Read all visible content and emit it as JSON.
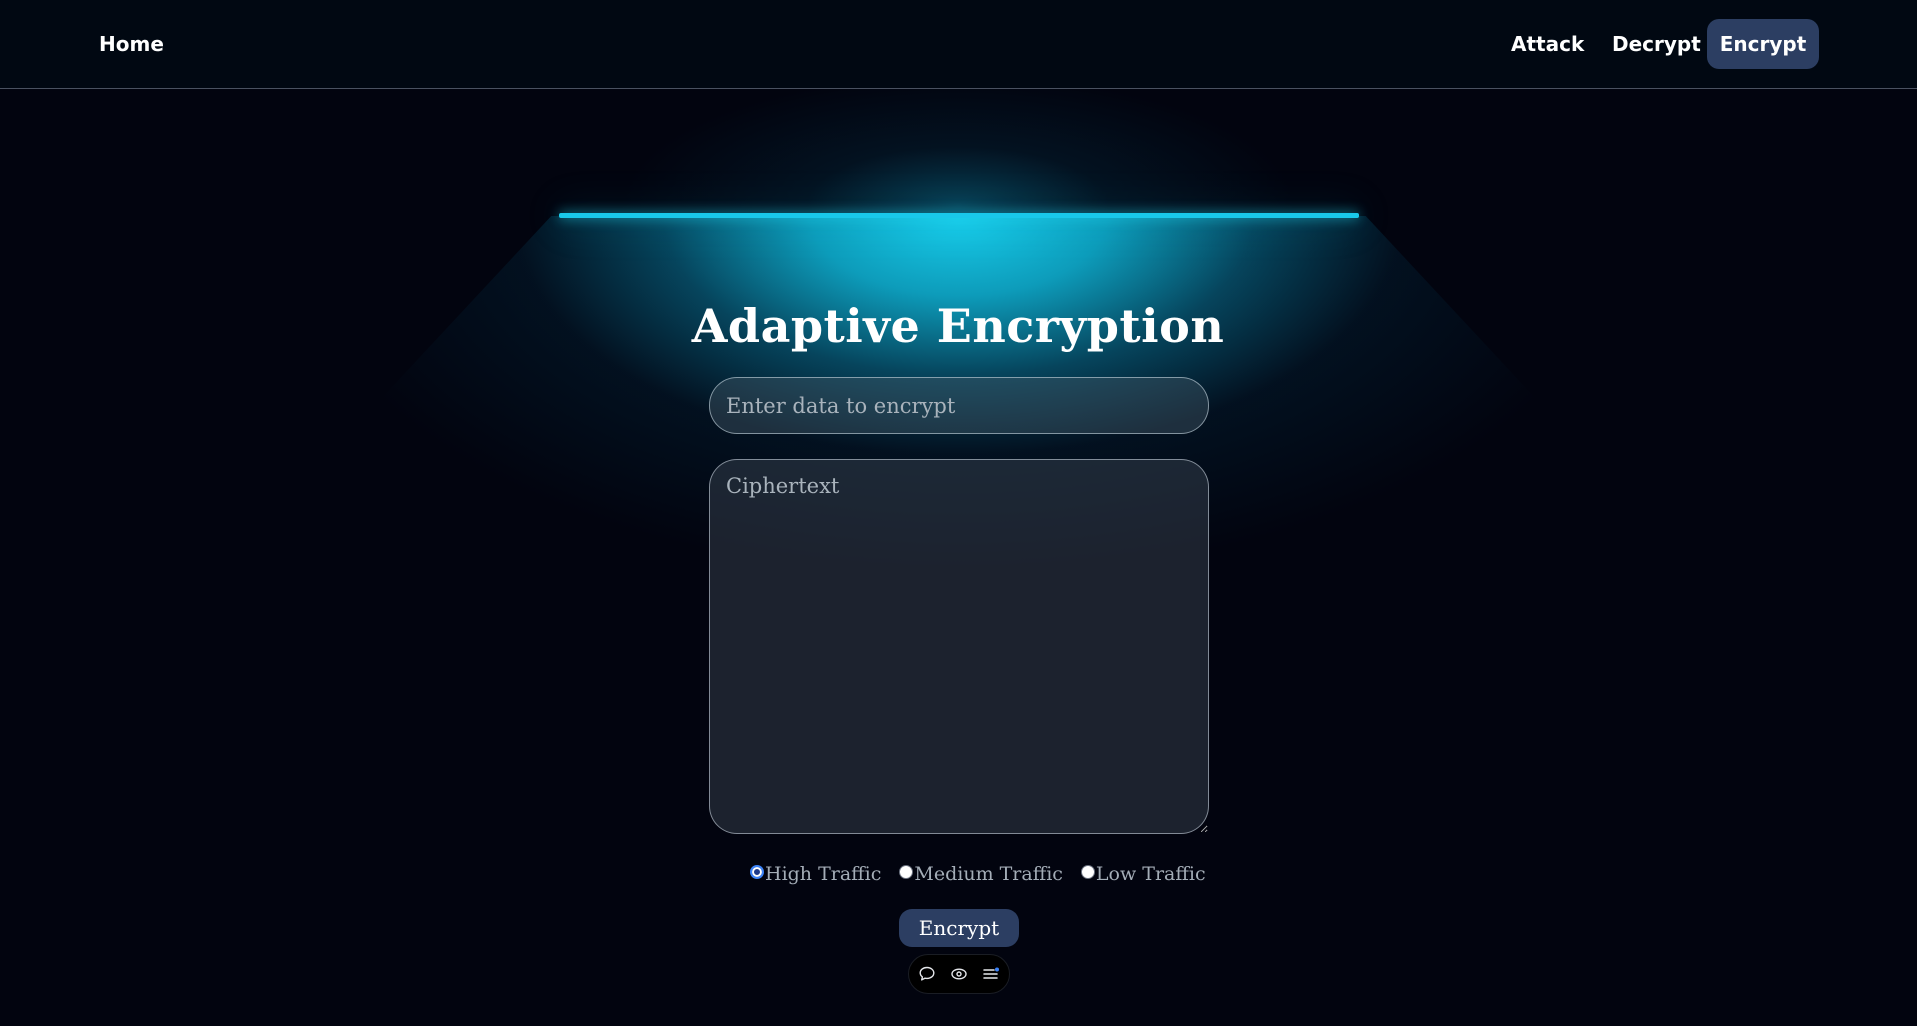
{
  "nav": {
    "home": "Home",
    "attack": "Attack",
    "decrypt": "Decrypt",
    "encrypt": "Encrypt",
    "active_tab": "Encrypt"
  },
  "main": {
    "title": "Adaptive Encryption",
    "data_input": {
      "placeholder": "Enter data to encrypt",
      "value": ""
    },
    "ciphertext": {
      "placeholder": "Ciphertext",
      "value": ""
    },
    "traffic_options": [
      {
        "label": "High Traffic",
        "selected": true
      },
      {
        "label": "Medium Traffic",
        "selected": false
      },
      {
        "label": "Low Traffic",
        "selected": false
      }
    ],
    "encrypt_button": "Encrypt"
  },
  "toolbar": {
    "icons": [
      "chat-bubble-icon",
      "eye-icon",
      "menu-icon"
    ]
  },
  "colors": {
    "accent": "#22d3ee",
    "button": "#2c3e62",
    "background": "#02040f"
  }
}
